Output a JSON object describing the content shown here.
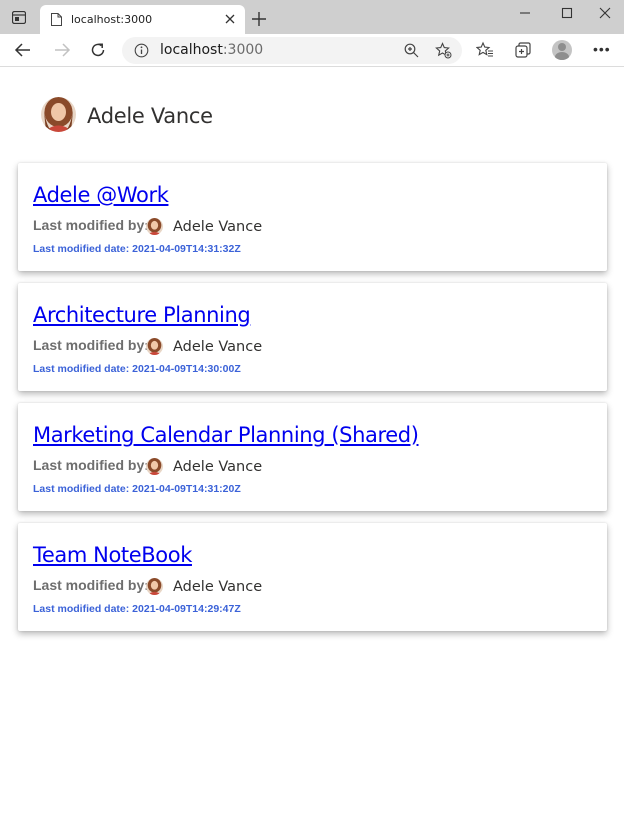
{
  "browser": {
    "tab_title": "localhost:3000",
    "url_host": "localhost",
    "url_port": ":3000"
  },
  "user": {
    "name": "Adele Vance"
  },
  "notebooks": [
    {
      "title": "Adele @Work",
      "modified_by_label": "Last modified by:",
      "modified_by": "Adele Vance",
      "modified_date": "Last modified date: 2021-04-09T14:31:32Z"
    },
    {
      "title": "Architecture Planning",
      "modified_by_label": "Last modified by:",
      "modified_by": "Adele Vance",
      "modified_date": "Last modified date: 2021-04-09T14:30:00Z"
    },
    {
      "title": "Marketing Calendar Planning (Shared)",
      "modified_by_label": "Last modified by:",
      "modified_by": "Adele Vance",
      "modified_date": "Last modified date: 2021-04-09T14:31:20Z"
    },
    {
      "title": "Team NoteBook",
      "modified_by_label": "Last modified by:",
      "modified_by": "Adele Vance",
      "modified_date": "Last modified date: 2021-04-09T14:29:47Z"
    }
  ],
  "colors": {
    "link": "#0000ee",
    "date_accent": "#3b62d8",
    "label_gray": "#6e6e6e"
  }
}
